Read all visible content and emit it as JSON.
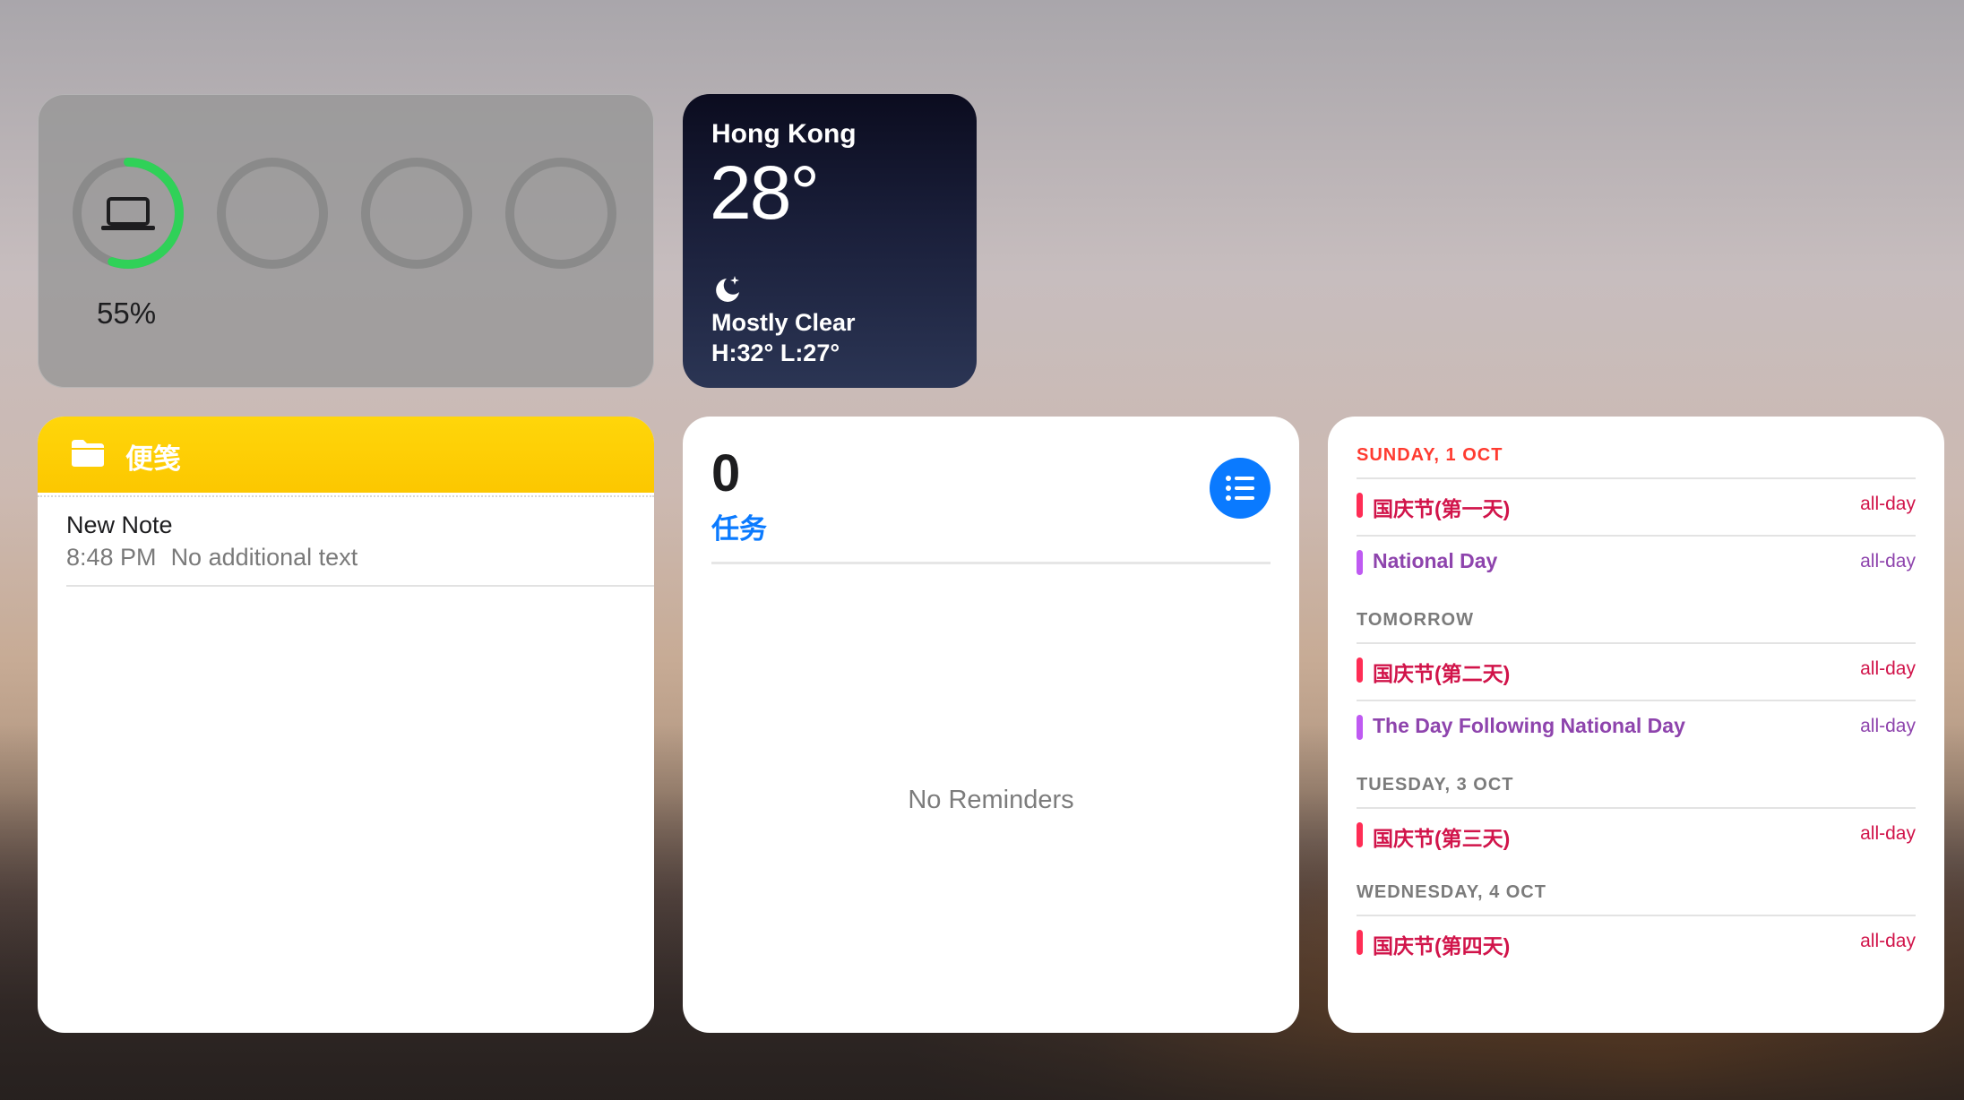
{
  "battery": {
    "devices": [
      {
        "icon": "laptop-icon",
        "level": 0.55,
        "label": "55%"
      },
      {
        "icon": "",
        "level": 0
      },
      {
        "icon": "",
        "level": 0
      },
      {
        "icon": "",
        "level": 0
      }
    ],
    "colors": {
      "ring_fill": "#30d158",
      "ring_track": "#8a8a8a"
    }
  },
  "weather": {
    "city": "Hong Kong",
    "temperature": "28°",
    "condition_icon": "moon-stars-icon",
    "condition": "Mostly Clear",
    "high_low": "H:32° L:27°"
  },
  "notes": {
    "folder_icon": "folder-icon",
    "folder_title": "便笺",
    "items": [
      {
        "title": "New Note",
        "time": "8:48 PM",
        "preview": "No additional text"
      }
    ]
  },
  "reminders": {
    "count": "0",
    "list_name": "任务",
    "list_icon": "list-icon",
    "empty_text": "No Reminders",
    "accent": "#0a7aff"
  },
  "calendar": {
    "sections": [
      {
        "heading": "SUNDAY, 1 OCT",
        "is_today": true,
        "events": [
          {
            "title": "国庆节(第一天)",
            "time": "all-day",
            "color": "#ff2d55"
          },
          {
            "title": "National Day",
            "time": "all-day",
            "color": "#bf5af2"
          }
        ]
      },
      {
        "heading": "TOMORROW",
        "is_today": false,
        "events": [
          {
            "title": "国庆节(第二天)",
            "time": "all-day",
            "color": "#ff2d55"
          },
          {
            "title": "The Day Following National Day",
            "time": "all-day",
            "color": "#bf5af2"
          }
        ]
      },
      {
        "heading": "TUESDAY, 3 OCT",
        "is_today": false,
        "events": [
          {
            "title": "国庆节(第三天)",
            "time": "all-day",
            "color": "#ff2d55"
          }
        ]
      },
      {
        "heading": "WEDNESDAY, 4 OCT",
        "is_today": false,
        "events": [
          {
            "title": "国庆节(第四天)",
            "time": "all-day",
            "color": "#ff2d55"
          }
        ]
      }
    ],
    "text_colors": {
      "#ff2d55": "#d1144a",
      "#bf5af2": "#8e44ad"
    }
  }
}
